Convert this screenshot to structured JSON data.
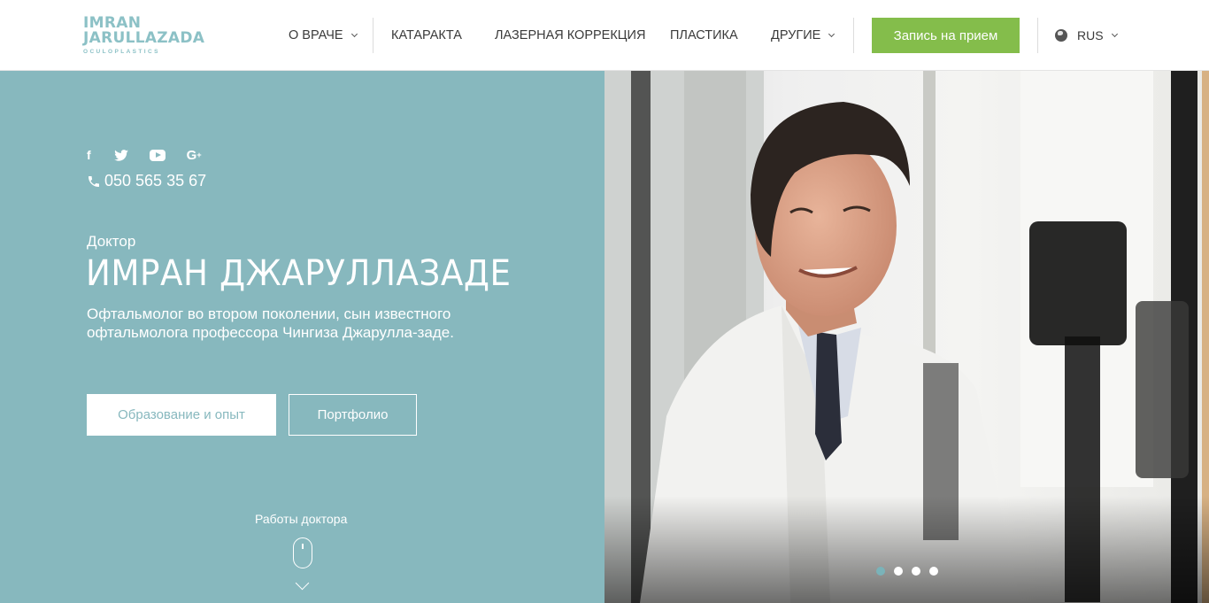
{
  "brand": {
    "line1": "IMRAN",
    "line2": "JARULLAZADA",
    "line3": "OCULOPLASTICS",
    "color": "#8cc1c6"
  },
  "nav": {
    "items": [
      {
        "label": "О ВРАЧЕ",
        "has_dropdown": true
      },
      {
        "label": "КАТАРАКТА",
        "has_dropdown": false
      },
      {
        "label": "ЛАЗЕРНАЯ КОРРЕКЦИЯ",
        "has_dropdown": false
      },
      {
        "label": "ПЛАСТИКА",
        "has_dropdown": false
      },
      {
        "label": "ДРУГИЕ",
        "has_dropdown": true
      }
    ],
    "cta_label": "Запись на прием",
    "cta_color": "#84bd4b",
    "language": "RUS"
  },
  "hero": {
    "background_color": "#87b8be",
    "socials": [
      "facebook-icon",
      "twitter-icon",
      "youtube-icon",
      "google-plus-icon"
    ],
    "social_labels": {
      "facebook": "f",
      "google": "G"
    },
    "phone": "050 565 35 67",
    "doctor_label": "Доктор",
    "doctor_name": "ИМРАН ДЖАРУЛЛАЗАДЕ",
    "description": "Офтальмолог во втором поколении, сын известного офтальмолога профессора Чингиза Джарулла-заде.",
    "button_education": "Образование и опыт",
    "button_portfolio": "Портфолио",
    "works_label": "Работы доктора"
  },
  "slider": {
    "total": 4,
    "active_index": 0,
    "active_color": "#7ab3b9"
  }
}
